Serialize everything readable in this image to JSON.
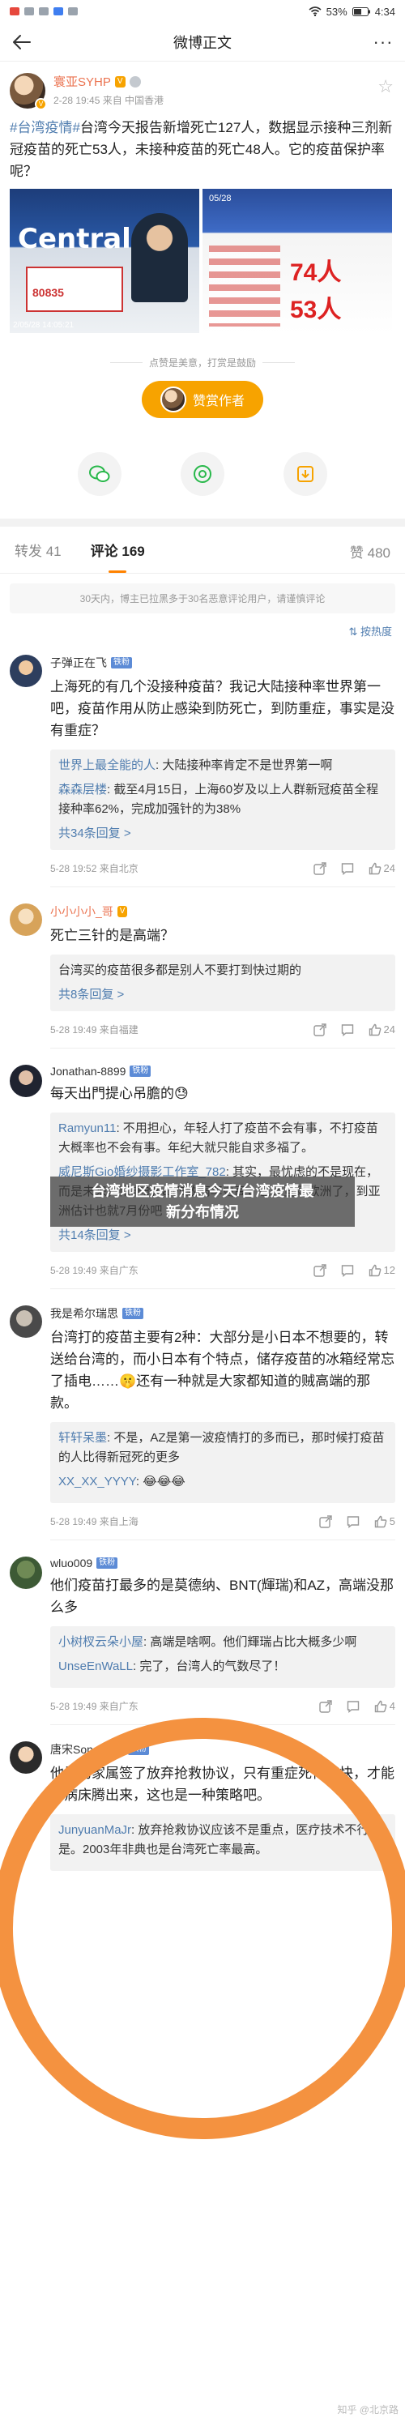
{
  "status_bar": {
    "time": "4:34",
    "battery": "53%"
  },
  "topbar": {
    "title": "微博正文"
  },
  "post": {
    "author": "寰亚SYHP",
    "meta": "2-28 19:45  来自 中国香港",
    "hashtag": "#台湾疫情#",
    "text": "台湾今天报告新增死亡127人，数据显示接种三剂新冠疫苗的死亡53人，未接种疫苗的死亡48人。它的疫苗保护率呢？",
    "image_left": {
      "word": "Central",
      "number": "80835",
      "stamp": "2/05/28 14:05:21"
    },
    "image_right": {
      "title": "05/28",
      "n1": "74人",
      "n2": "53人"
    }
  },
  "reward": {
    "tip": "点赞是美意，打赏是鼓励",
    "button": "赞赏作者"
  },
  "tabs": {
    "repost": "转发 41",
    "comment": "评论 169",
    "like": "赞 480"
  },
  "notice": "30天内，博主已拉黑多于30名恶意评论用户，请谨慎评论",
  "sort": "按热度",
  "watermark": {
    "line1": "台湾地区疫情消息今天/台湾疫情最",
    "line2": "新分布情况"
  },
  "comments": [
    {
      "name": "子弹正在飞",
      "badge": "铁粉",
      "text": "上海死的有几个没接种疫苗？我记大陆接种率世界第一吧，疫苗作用从防止感染到防死亡，到防重症，事实是没有重症？",
      "replies": [
        {
          "name": "世界上最全能的人",
          "text": ": 大陆接种率肯定不是世界第一啊"
        },
        {
          "name": "森森层楼",
          "text": ": 截至4月15日，上海60岁及以上人群新冠疫苗全程接种率62%，完成加强针的为38%"
        }
      ],
      "more": "共34条回复 >",
      "time": "5-28 19:52  来自北京",
      "likes": "24"
    },
    {
      "name": "小小小小_哥",
      "badge": "",
      "text": "死亡三针的是高端？",
      "replies": [
        {
          "name": "",
          "text": "台湾买的疫苗很多都是别人不要打到快过期的"
        }
      ],
      "more": "共8条回复 >",
      "time": "5-28 19:49  来自福建",
      "likes": "24"
    },
    {
      "name": "Jonathan-8899",
      "badge": "铁粉",
      "text": "每天出門提心吊膽的😓",
      "replies": [
        {
          "name": "Ramyun11",
          "text": ": 不用担心，年轻人打了疫苗不会有事，不打疫苗大概率也不会有事。年纪大就只能自求多福了。"
        },
        {
          "name": "威尼斯Gio婚纱摄影工作室_782",
          "text": ": 其实，最忧虑的不是现在，而是未来，南非的ba4/5致病率更高，已经登录欧洲了，到亚洲估计也就7月份吧"
        }
      ],
      "more": "共14条回复 >",
      "time": "5-28 19:49  来自广东",
      "likes": "12"
    },
    {
      "name": "我是希尔瑞思",
      "badge": "铁粉",
      "text": "台湾打的疫苗主要有2种：大部分是小日本不想要的，转送给台湾的，而小日本有个特点，储存疫苗的冰箱经常忘了插电……🤫还有一种就是大家都知道的贼高端的那款。",
      "replies": [
        {
          "name": "轩轩呆墨",
          "text": ": 不是，AZ是第一波疫情打的多而已，那时候打疫苗的人比得新冠死的更多"
        },
        {
          "name": "XX_XX_YYYY",
          "text": ": 😂😂😂"
        }
      ],
      "more": "",
      "time": "5-28 19:49  来自上海",
      "likes": "5"
    },
    {
      "name": "wluo009",
      "badge": "铁粉",
      "text": "他们疫苗打最多的是莫德纳、BNT(輝瑞)和AZ，高端没那么多",
      "replies": [
        {
          "name": "小树杈云朵小屋",
          "text": ": 高端是啥啊。他们輝瑞占比大概多少啊"
        },
        {
          "name": "UnseEnWaLL",
          "text": ": 完了，台湾人的气数尽了！"
        }
      ],
      "more": "",
      "time": "5-28 19:49  来自广东",
      "likes": "4"
    },
    {
      "name": "唐宋SongTang",
      "badge": "铁粉",
      "text": "他是劝家属签了放弃抢救协议，只有重症死得够快，才能把病床腾出来，这也是一种策略吧。",
      "replies": [
        {
          "name": "JunyuanMaJr",
          "text": ": 放弃抢救协议应该不是重点，医疗技术不行才是。2003年非典也是台湾死亡率最高。"
        }
      ],
      "more": "",
      "time": "",
      "likes": ""
    }
  ],
  "footer_mark": "知乎 @北京路"
}
